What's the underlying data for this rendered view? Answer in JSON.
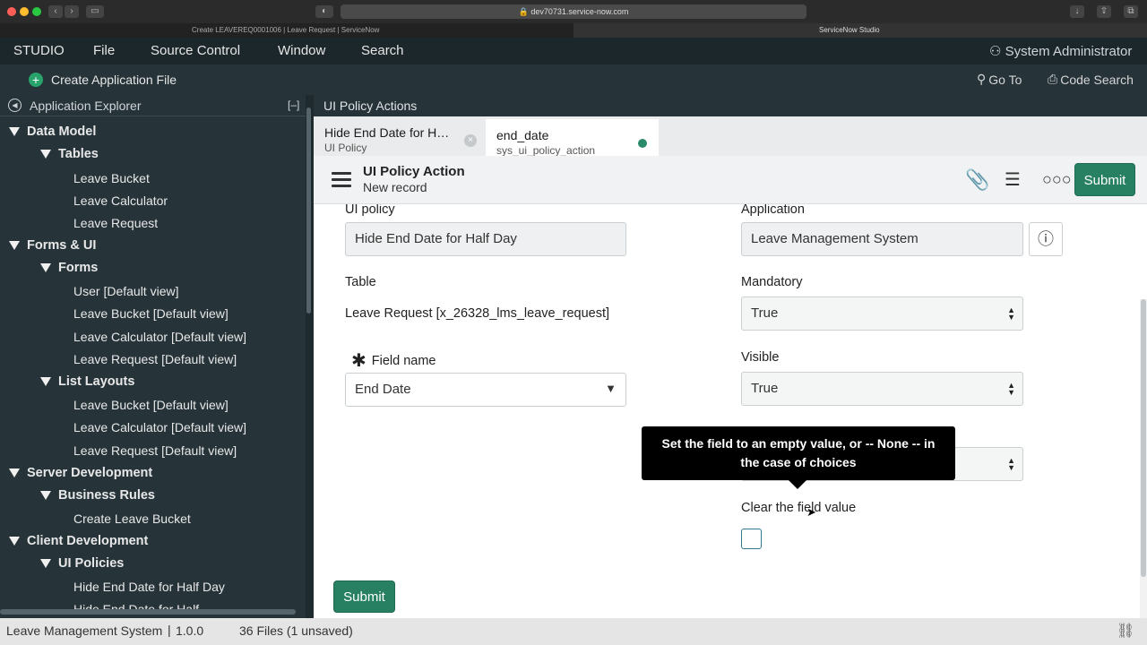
{
  "browser": {
    "url": "dev70731.service-now.com",
    "tabs": [
      {
        "label": "Create LEAVEREQ0001006 | Leave Request | ServiceNow"
      },
      {
        "label": "ServiceNow Studio"
      }
    ]
  },
  "menubar": {
    "brand": "STUDIO",
    "items": [
      "File",
      "Source Control",
      "Window",
      "Search"
    ],
    "user": "System Administrator"
  },
  "toolbar": {
    "create_label": "Create Application File",
    "goto_label": "Go To",
    "code_search_label": "Code Search"
  },
  "explorer": {
    "title": "Application Explorer",
    "collapse": "[–]",
    "items": [
      "Data Model",
      "Tables",
      "Leave Bucket",
      "Leave Calculator",
      "Leave Request",
      "Forms & UI",
      "Forms",
      "User [Default view]",
      "Leave Bucket [Default view]",
      "Leave Calculator [Default view]",
      "Leave Request [Default view]",
      "List Layouts",
      "Leave Bucket [Default view]",
      "Leave Calculator [Default view]",
      "Leave Request [Default view]",
      "Server Development",
      "Business Rules",
      "Create Leave Bucket",
      "Client Development",
      "UI Policies",
      "Hide End Date for Half Day",
      "Hide End Date for Half"
    ]
  },
  "main": {
    "section_title": "UI Policy Actions",
    "tabs": [
      {
        "title": "Hide End Date for H…",
        "subtitle": "UI Policy"
      },
      {
        "title": "end_date",
        "subtitle": "sys_ui_policy_action"
      }
    ],
    "form_title": "UI Policy Action",
    "form_subtitle": "New record",
    "submit_label": "Submit"
  },
  "form": {
    "ui_policy_label": "UI policy",
    "ui_policy_value": "Hide End Date for Half Day",
    "application_label": "Application",
    "application_value": "Leave Management System",
    "table_label": "Table",
    "table_value": "Leave Request [x_26328_lms_leave_request]",
    "mandatory_label": "Mandatory",
    "mandatory_value": "True",
    "field_name_label": "Field name",
    "field_name_value": "End Date",
    "visible_label": "Visible",
    "visible_value": "True",
    "clear_label": "Clear the field value",
    "tooltip": "Set the field to an empty value, or -- None -- in the case of choices",
    "submit_label": "Submit"
  },
  "status": {
    "app": "Leave Management System",
    "version": "1.0.0",
    "files": "36 Files (1 unsaved)"
  },
  "colors": {
    "accent": "#278061",
    "header_bg": "#1c272c",
    "panel_bg": "#26343a"
  }
}
